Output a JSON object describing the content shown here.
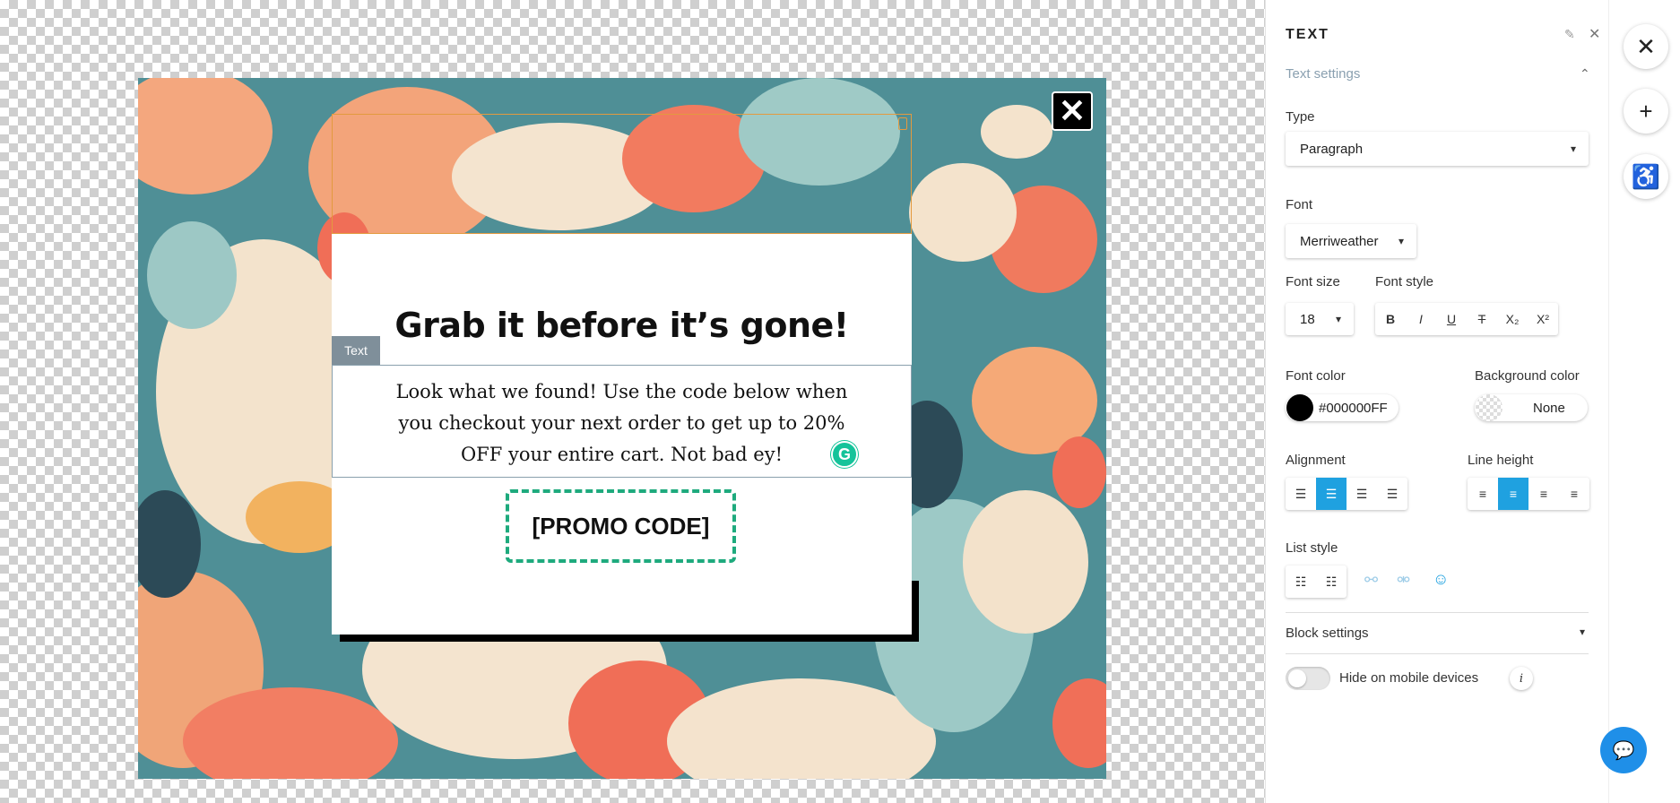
{
  "popup": {
    "close_glyph": "✕",
    "headline": "Grab it before it’s gone!",
    "text_tag": "Text",
    "paragraph": "Look what we found! Use the code below when you checkout your next order to get up to 20% OFF your entire cart. Not bad ey!",
    "promo_code": "[PROMO CODE]",
    "grammarly_glyph": "G"
  },
  "panel": {
    "title": "TEXT",
    "section": "Text settings",
    "type_label": "Type",
    "type_value": "Paragraph",
    "font_label": "Font",
    "font_value": "Merriweather",
    "font_size_label": "Font size",
    "font_size_value": "18",
    "font_style_label": "Font style",
    "font_style_buttons": [
      "B",
      "I",
      "U",
      "T",
      "X₂",
      "X²"
    ],
    "font_color_label": "Font color",
    "font_color_value": "#000000FF",
    "bg_color_label": "Background color",
    "bg_color_value": "None",
    "alignment_label": "Alignment",
    "alignment_options": [
      "left",
      "center",
      "right",
      "justify"
    ],
    "alignment_selected": "center",
    "line_height_label": "Line height",
    "list_style_label": "List style",
    "block_settings_label": "Block settings",
    "hide_mobile_label": "Hide on mobile devices",
    "hide_mobile_enabled": false
  },
  "rail": {
    "icons": [
      "close-icon",
      "plus-icon",
      "accessibility-icon"
    ]
  },
  "colors": {
    "accent": "#1fa1e0",
    "promo_border": "#1eaa7d",
    "chat": "#1f8fe8"
  }
}
